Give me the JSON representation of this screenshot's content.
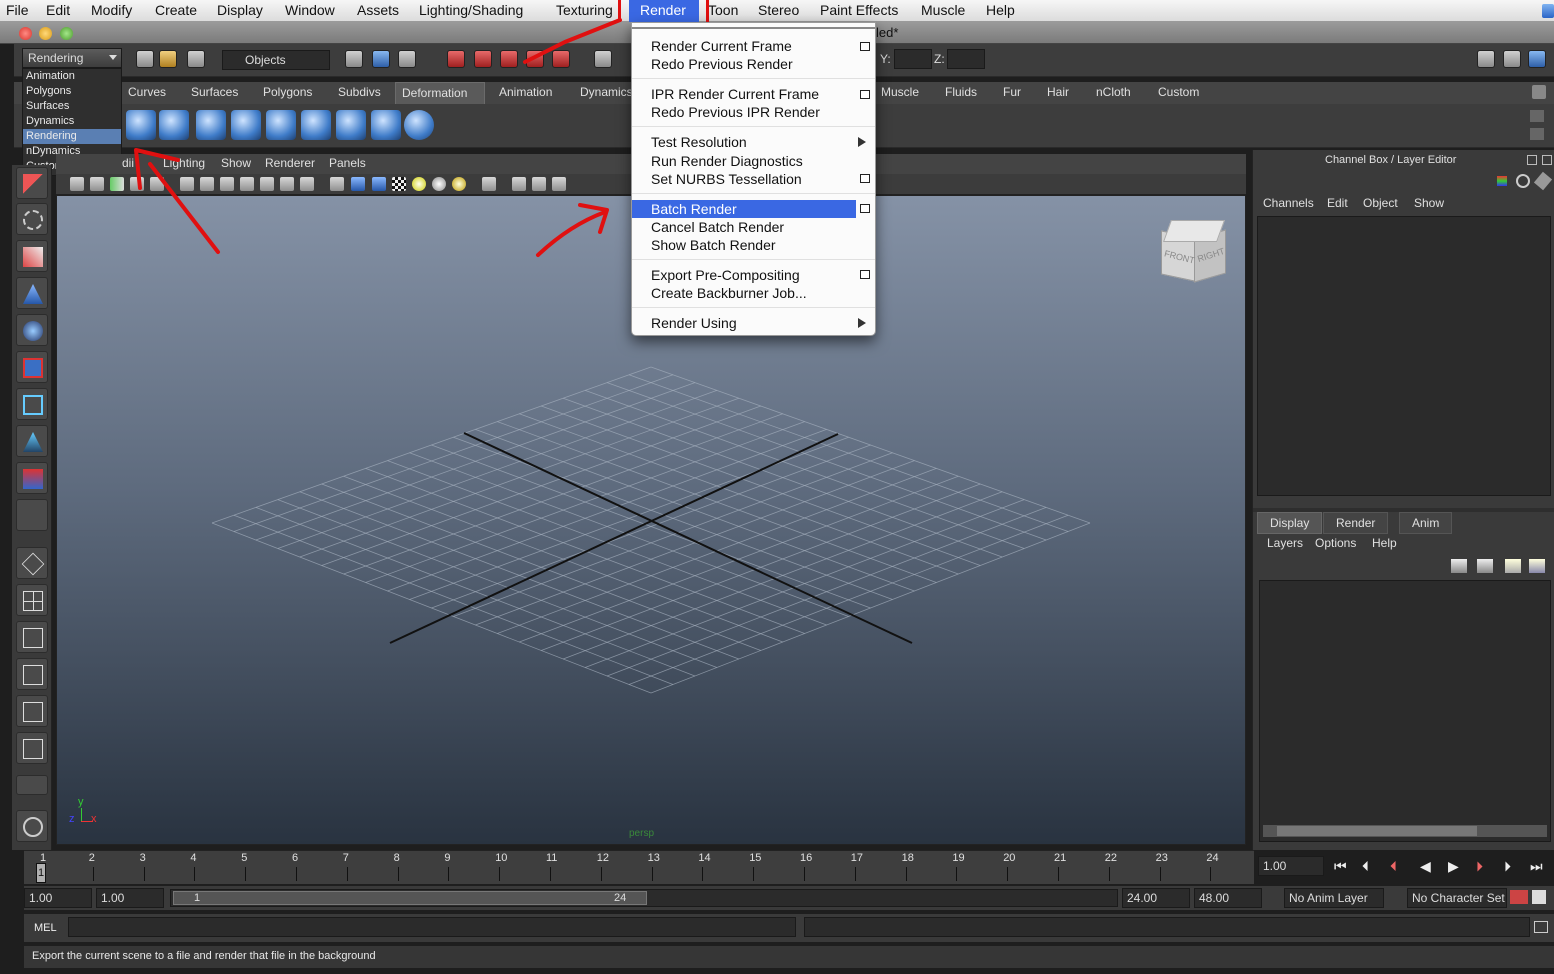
{
  "menubar": {
    "items": [
      "File",
      "Edit",
      "Modify",
      "Create",
      "Display",
      "Window",
      "Assets",
      "Lighting/Shading",
      "Texturing",
      "Render",
      "Toon",
      "Stereo",
      "Paint Effects",
      "Muscle",
      "Help"
    ],
    "active": "Render",
    "toon_visible": "Toon"
  },
  "titlebar": {
    "title_fragment": "led*"
  },
  "statusline": {
    "menuset_value": "Rendering",
    "selection_mask": "Objects",
    "y_label": "Y:",
    "z_label": "Z:"
  },
  "menuset_list": [
    "Animation",
    "Polygons",
    "Surfaces",
    "Dynamics",
    "Rendering",
    "nDynamics",
    "Customize ..."
  ],
  "menuset_selected": "Rendering",
  "shelf_tabs": [
    "Curves",
    "Surfaces",
    "Polygons",
    "Subdivs",
    "Deformation",
    "Animation",
    "Dynamics",
    "Muscle",
    "Fluids",
    "Fur",
    "Hair",
    "nCloth",
    "Custom"
  ],
  "shelf_active": "Deformation",
  "panel_menu": [
    "dii",
    "Lighting",
    "Show",
    "Renderer",
    "Panels"
  ],
  "viewport": {
    "camera": "persp",
    "viewcube_front": "FRONT",
    "viewcube_right": "RIGHT",
    "axis_x": "x",
    "axis_y": "y",
    "axis_z": "z"
  },
  "render_menu": {
    "items": [
      {
        "label": "Render Current Frame",
        "option": true
      },
      {
        "label": "Redo Previous Render"
      },
      {
        "label": "IPR Render Current Frame",
        "option": true
      },
      {
        "label": "Redo Previous IPR Render"
      },
      {
        "label": "Test Resolution",
        "submenu": true
      },
      {
        "label": "Run Render Diagnostics"
      },
      {
        "label": "Set NURBS Tessellation",
        "option": true
      },
      {
        "label": "Batch Render",
        "option": true,
        "highlighted": true
      },
      {
        "label": "Cancel Batch Render"
      },
      {
        "label": "Show Batch Render"
      },
      {
        "label": "Export Pre-Compositing",
        "option": true
      },
      {
        "label": "Create Backburner Job..."
      },
      {
        "label": "Render Using",
        "submenu": true
      }
    ]
  },
  "channel_box": {
    "title": "Channel Box / Layer Editor",
    "menu": [
      "Channels",
      "Edit",
      "Object",
      "Show"
    ],
    "layer_tabs": [
      "Display",
      "Render",
      "Anim"
    ],
    "layer_active": "Display",
    "layer_menu": [
      "Layers",
      "Options",
      "Help"
    ]
  },
  "timeline": {
    "ticks": [
      "1",
      "2",
      "3",
      "4",
      "5",
      "6",
      "7",
      "8",
      "9",
      "10",
      "11",
      "12",
      "13",
      "14",
      "15",
      "16",
      "17",
      "18",
      "19",
      "20",
      "21",
      "22",
      "23",
      "24"
    ],
    "current_frame_marker": "1",
    "current_time": "1.00"
  },
  "range_slider": {
    "start_time": "1.00",
    "playback_start": "1.00",
    "range_start_label": "1",
    "range_end_label": "24",
    "playback_end": "24.00",
    "end_time": "48.00",
    "anim_layer": "No Anim Layer",
    "character_set": "No Character Set"
  },
  "command_line": {
    "label": "MEL"
  },
  "help_line": {
    "text": "Export the current scene to a file and render that file in the background"
  },
  "colors": {
    "highlight": "#3a68e3",
    "annotation": "#e01010",
    "menuset_selected": "#5a7fb3"
  }
}
